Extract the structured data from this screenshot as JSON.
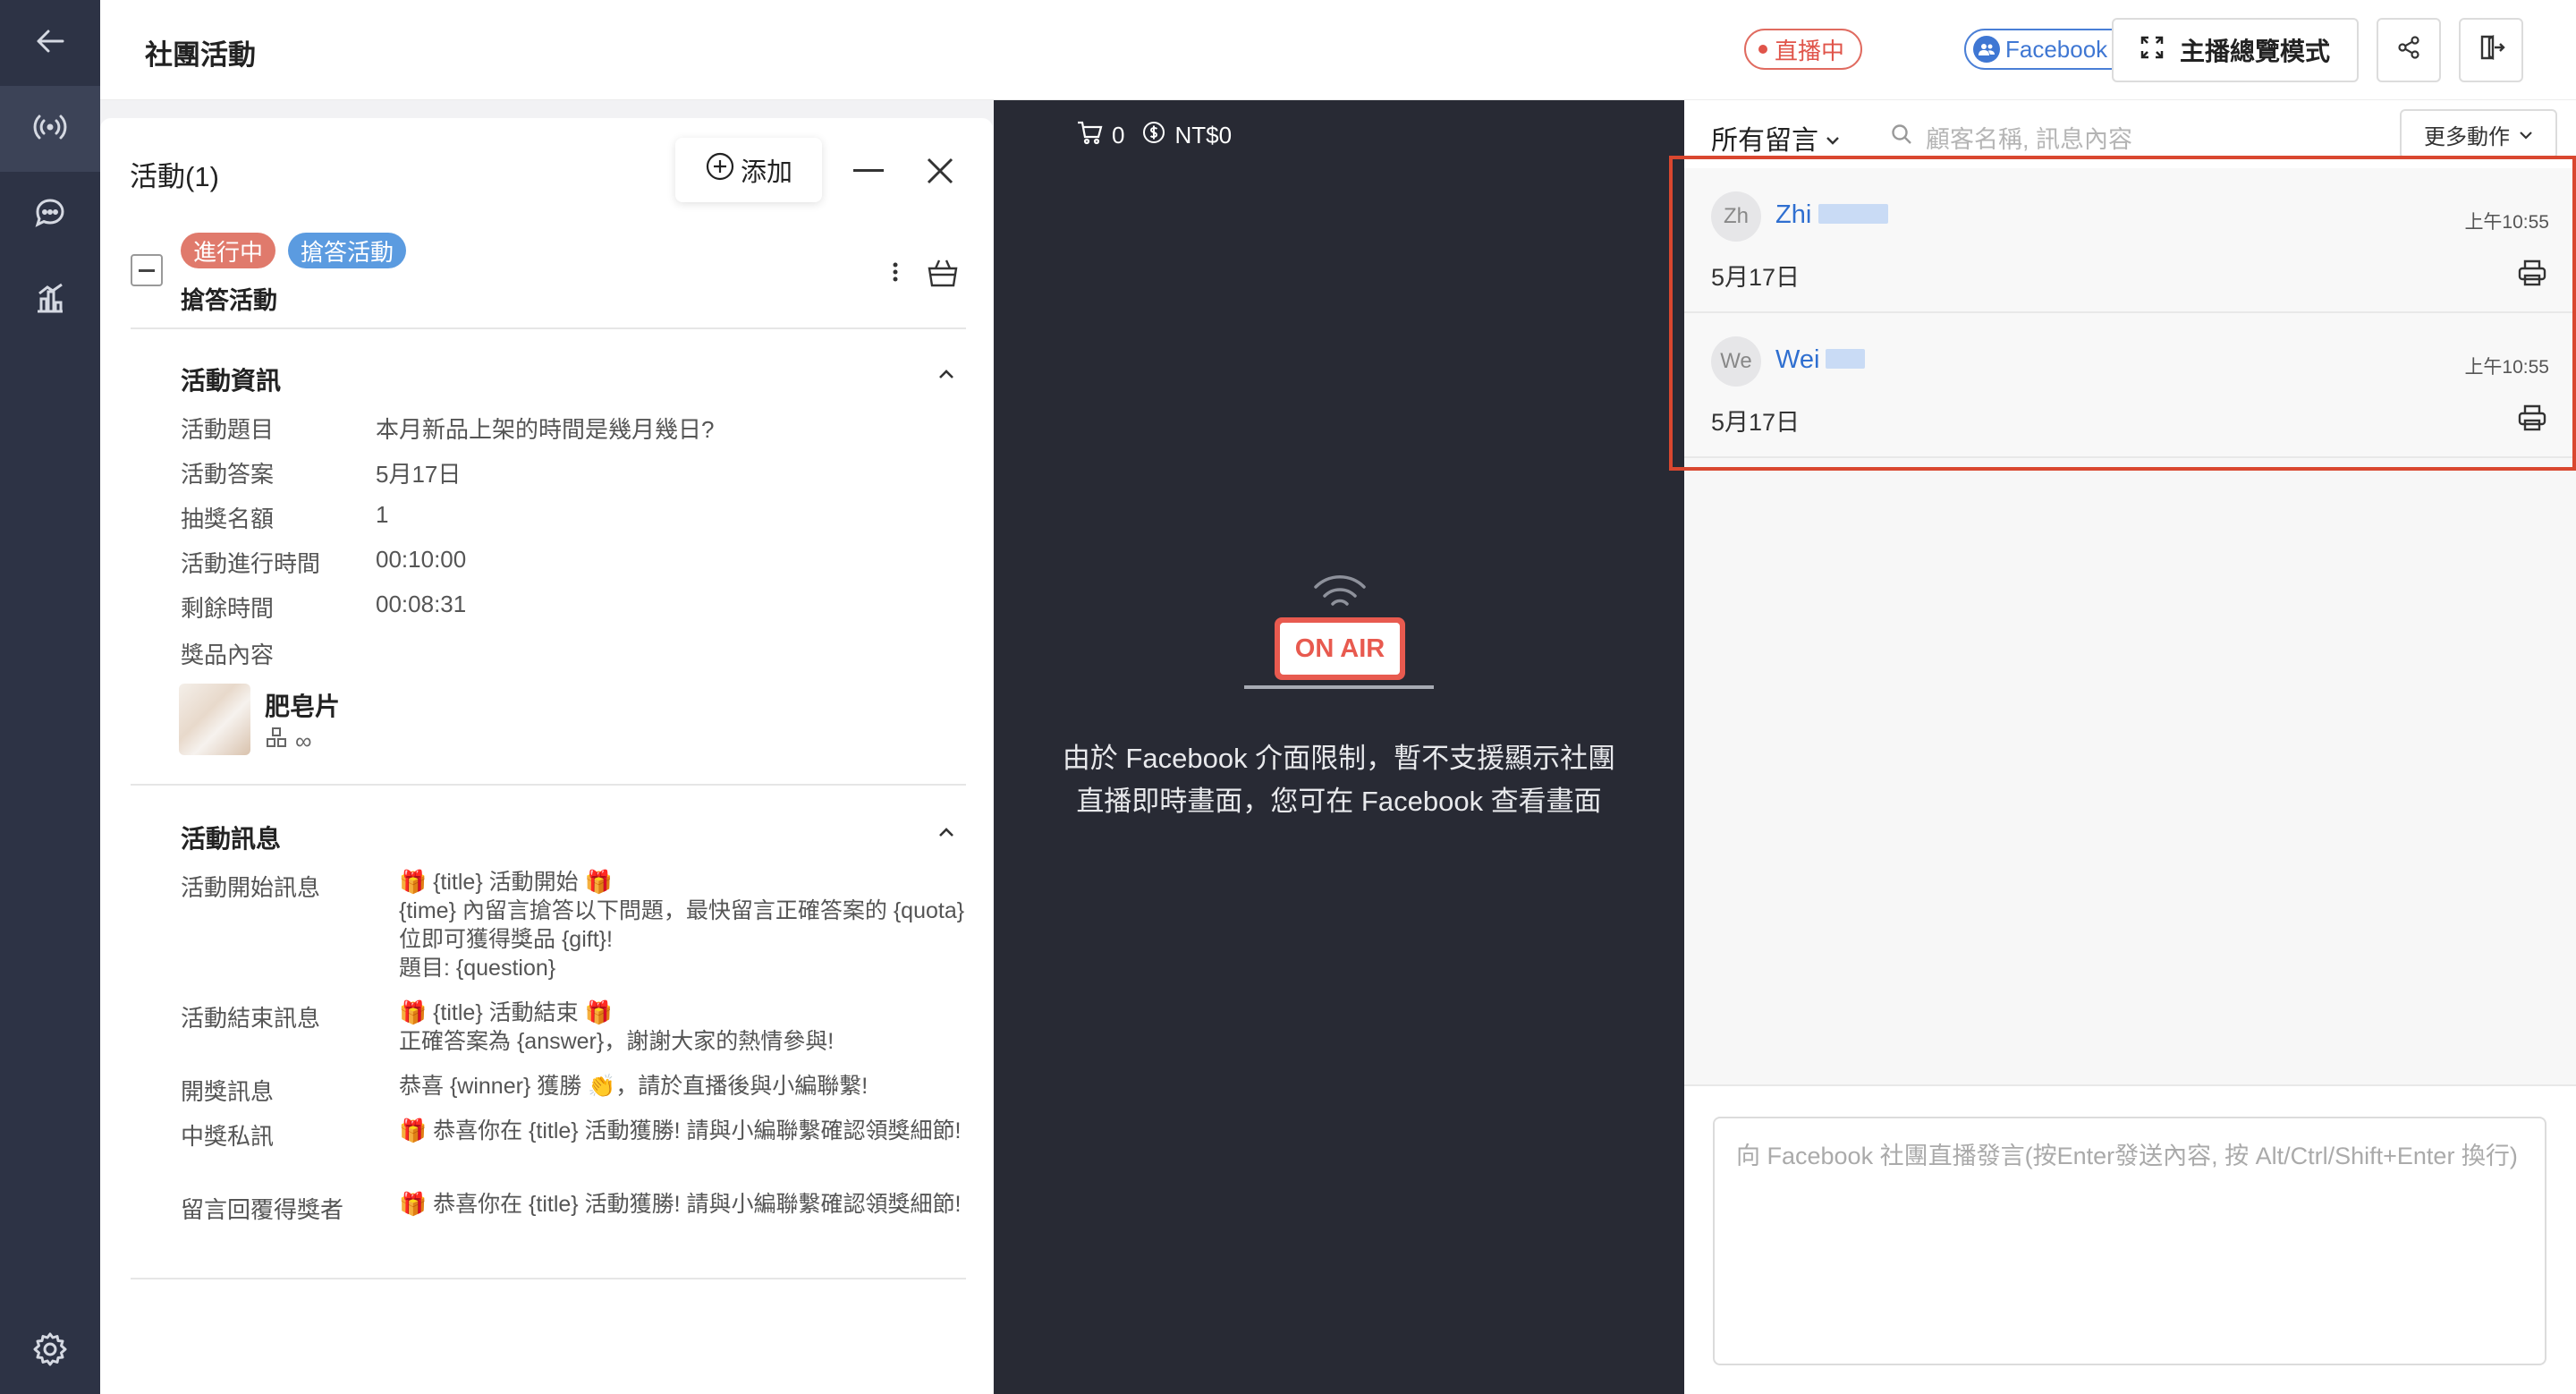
{
  "rail": {
    "items": [
      {
        "name": "back-arrow-icon"
      },
      {
        "name": "live-broadcast-icon"
      },
      {
        "name": "chat-icon"
      },
      {
        "name": "stats-icon"
      },
      {
        "name": "settings-gear-icon"
      }
    ]
  },
  "header": {
    "title": "社團活動",
    "live_badge": "直播中",
    "group_badge": "Facebook Group",
    "overview_button": "主播總覽模式"
  },
  "activity_panel": {
    "title": "活動(1)",
    "add_button": "添加",
    "activity": {
      "status_tag": "進行中",
      "type_tag": "搶答活動",
      "name": "搶答活動"
    },
    "info_section": {
      "title": "活動資訊",
      "rows": [
        {
          "label": "活動題目",
          "value": "本月新品上架的時間是幾月幾日?"
        },
        {
          "label": "活動答案",
          "value": "5月17日"
        },
        {
          "label": "抽獎名額",
          "value": "1"
        },
        {
          "label": "活動進行時間",
          "value": "00:10:00"
        },
        {
          "label": "剩餘時間",
          "value": "00:08:31"
        }
      ],
      "prize_label": "獎品內容",
      "prize_name": "肥皂片",
      "prize_quantity": "∞"
    },
    "message_section": {
      "title": "活動訊息",
      "rows": [
        {
          "label": "活動開始訊息",
          "value": "🎁 {title} 活動開始 🎁\n{time} 內留言搶答以下問題，最快留言正確答案的 {quota} 位即可獲得獎品 {gift}!\n題目: {question}"
        },
        {
          "label": "活動結束訊息",
          "value": "🎁 {title} 活動結束 🎁\n正確答案為 {answer}，謝謝大家的熱情參與!"
        },
        {
          "label": "開獎訊息",
          "value": "恭喜 {winner} 獲勝 👏，請於直播後與小編聯繫!"
        },
        {
          "label": "中獎私訊",
          "value": "🎁 恭喜你在 {title} 活動獲勝! 請與小編聯繫確認領獎細節!"
        },
        {
          "label": "留言回覆得獎者",
          "value": "🎁 恭喜你在 {title} 活動獲勝! 請與小編聯繫確認領獎細節!"
        }
      ]
    }
  },
  "video": {
    "cart_count": "0",
    "cart_total": "NT$0",
    "on_air_label": "ON AIR",
    "message": "由於 Facebook 介面限制，暫不支援顯示社團直播即時畫面，您可在 Facebook 查看畫面"
  },
  "comments": {
    "filter_label": "所有留言",
    "search_placeholder": "顧客名稱, 訊息內容",
    "more_actions": "更多動作",
    "items": [
      {
        "avatar": "Zh",
        "name": "Zhi",
        "time": "上午10:55",
        "text": "5月17日"
      },
      {
        "avatar": "We",
        "name": "Wei",
        "time": "上午10:55",
        "text": "5月17日"
      }
    ],
    "composer_placeholder": "向 Facebook 社團直播發言(按Enter發送內容, 按 Alt/Ctrl/Shift+Enter 換行)"
  },
  "colors": {
    "rail_bg": "#2d3345",
    "live_red": "#e0544a",
    "fb_blue": "#3f77d3",
    "status_tag": "#e07a6c",
    "type_tag": "#5b9be0",
    "highlight": "#d9472f"
  }
}
